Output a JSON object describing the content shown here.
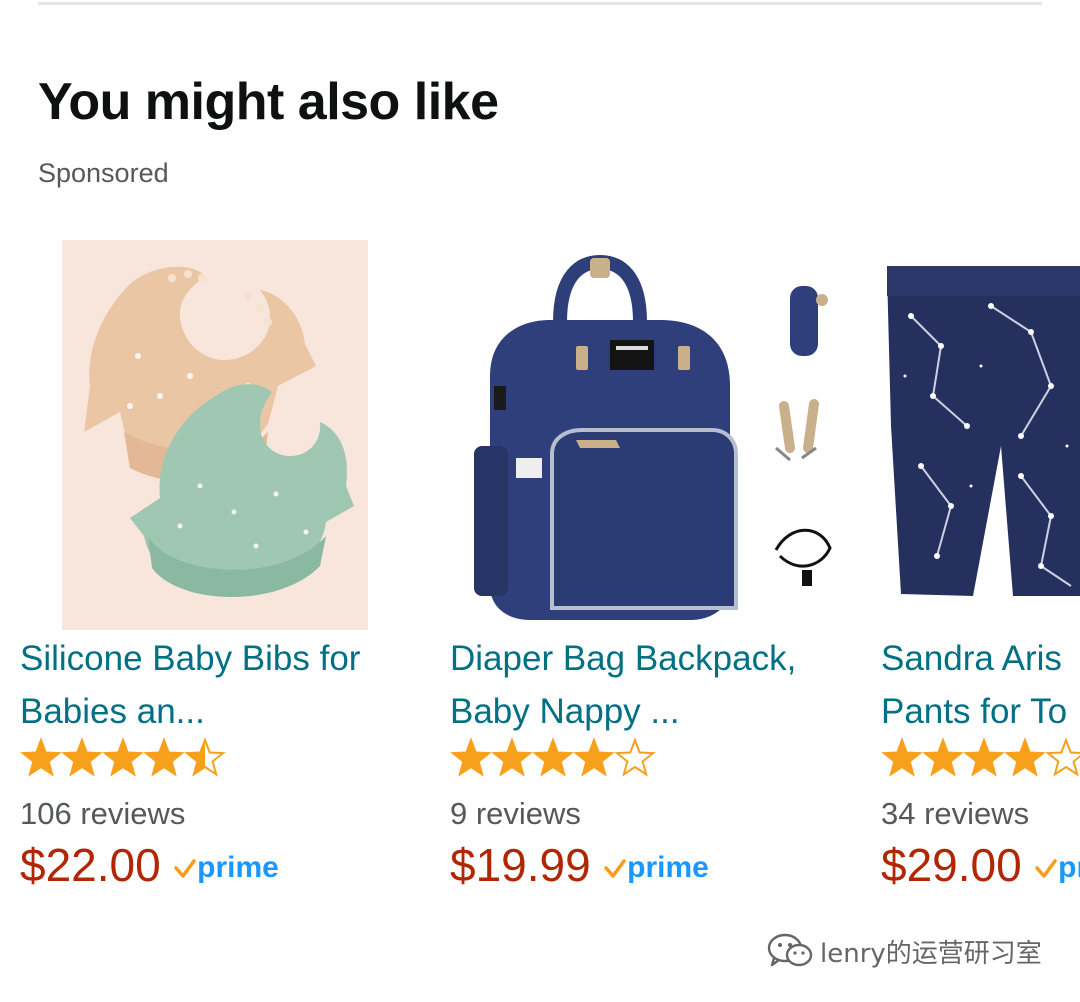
{
  "section": {
    "title": "You might also like",
    "sponsored_label": "Sponsored"
  },
  "products": [
    {
      "title": "Silicone Baby Bibs for\nBabies an...",
      "rating": 4.5,
      "reviews": "106 reviews",
      "price": "$22.00",
      "badge": "prime"
    },
    {
      "title": "Diaper Bag Backpack,\nBaby Nappy ...",
      "rating": 4,
      "reviews": "9 reviews",
      "price": "$19.99",
      "badge": "prime"
    },
    {
      "title": "Sandra Aris\nPants for To",
      "rating": 4,
      "reviews": "34 reviews",
      "price": "$29.00",
      "badge": "prime"
    }
  ],
  "watermark": {
    "text": "lenry的运营研习室",
    "icon": "wechat-icon"
  },
  "colors": {
    "link": "#007185",
    "price": "#b12704",
    "star": "#f7a01c",
    "prime": "#1a98ff",
    "prime_check": "#f79c1b"
  }
}
